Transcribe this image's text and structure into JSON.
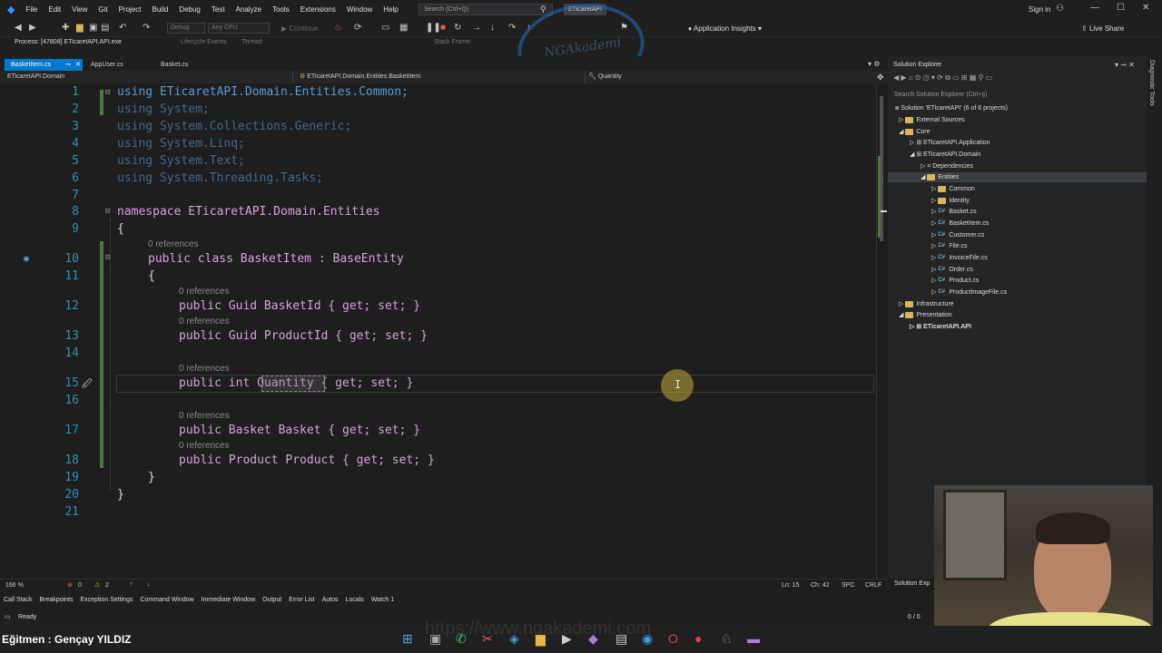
{
  "menu": {
    "items": [
      "File",
      "Edit",
      "View",
      "Git",
      "Project",
      "Build",
      "Debug",
      "Test",
      "Analyze",
      "Tools",
      "Extensions",
      "Window",
      "Help"
    ],
    "search_placeholder": "Search (Ctrl+Q)",
    "solution_badge": "ETicaretAPI",
    "sign_in": "Sign in"
  },
  "toolbar": {
    "config": "Debug",
    "platform": "Any CPU",
    "continue_label": "Continue",
    "app_insights": "Application Insights",
    "live_share": "Live Share"
  },
  "debugbar": {
    "process": "Process: [47808] ETicaretAPI.API.exe",
    "lifecycle": "Lifecycle Events",
    "thread": "Thread:",
    "stack_frame": "Stack Frame:"
  },
  "tabs": [
    "BasketItem.cs",
    "AppUser.cs",
    "Basket.cs"
  ],
  "navbar": {
    "project": "ETicaretAPI.Domain",
    "type": "ETicaretAPI.Domain.Entities.BasketItem",
    "member": "Quantity"
  },
  "code": {
    "line_numbers": [
      "1",
      "2",
      "3",
      "4",
      "5",
      "6",
      "7",
      "8",
      "9",
      "10",
      "11",
      "12",
      "13",
      "14",
      "15",
      "16",
      "17",
      "18",
      "19",
      "20",
      "21"
    ],
    "lines": [
      "using ETicaretAPI.Domain.Entities.Common;",
      "using System;",
      "using System.Collections.Generic;",
      "using System.Linq;",
      "using System.Text;",
      "using System.Threading.Tasks;",
      "",
      "namespace ETicaretAPI.Domain.Entities",
      "{",
      "public class BasketItem : BaseEntity",
      "{",
      "public Guid BasketId { get; set; }",
      "public Guid ProductId { get; set; }",
      "",
      "public int Quantity { get; set; }",
      "",
      "public Basket Basket { get; set; }",
      "public Product Product { get; set; }",
      "}",
      "}",
      ""
    ],
    "references_label": "0 references"
  },
  "status": {
    "zoom": "166 %",
    "errors": "0",
    "warnings": "2",
    "line": "Ln: 15",
    "col": "Ch: 42",
    "spc": "SPC",
    "crlf": "CRLF"
  },
  "tool_windows": [
    "Call Stack",
    "Breakpoints",
    "Exception Settings",
    "Command Window",
    "Immediate Window",
    "Output",
    "Error List",
    "Autos",
    "Locals",
    "Watch 1"
  ],
  "ready": "Ready",
  "ready_right": "0 / 0",
  "solution_explorer": {
    "title": "Solution Explorer",
    "search_placeholder": "Search Solution Explorer (Ctrl+ş)",
    "solution": "Solution 'ETicaretAPI' (6 of 6 projects)",
    "nodes": [
      "External Sources",
      "Core",
      "ETicaretAPI.Application",
      "ETicaretAPI.Domain",
      "Dependencies",
      "Entities",
      "Common",
      "Identity",
      "Basket.cs",
      "BasketItem.cs",
      "Customer.cs",
      "File.cs",
      "InvoiceFile.cs",
      "Order.cs",
      "Product.cs",
      "ProductImageFile.cs",
      "Infrastructure",
      "Presentation",
      "ETicaretAPI.API"
    ],
    "bottom_tab": "Solution Exp"
  },
  "diagnostic_tools": "Diagnostic Tools",
  "watermark": {
    "brand": "NGAkademi",
    "url": "https://www.ngakademi.com"
  },
  "instructor": "Eğitmen : Gençay YILDIZ",
  "colors": {
    "accent": "#007acc",
    "keyword": "#569cd6",
    "type": "#4ec9b0",
    "control": "#d8a0df"
  }
}
